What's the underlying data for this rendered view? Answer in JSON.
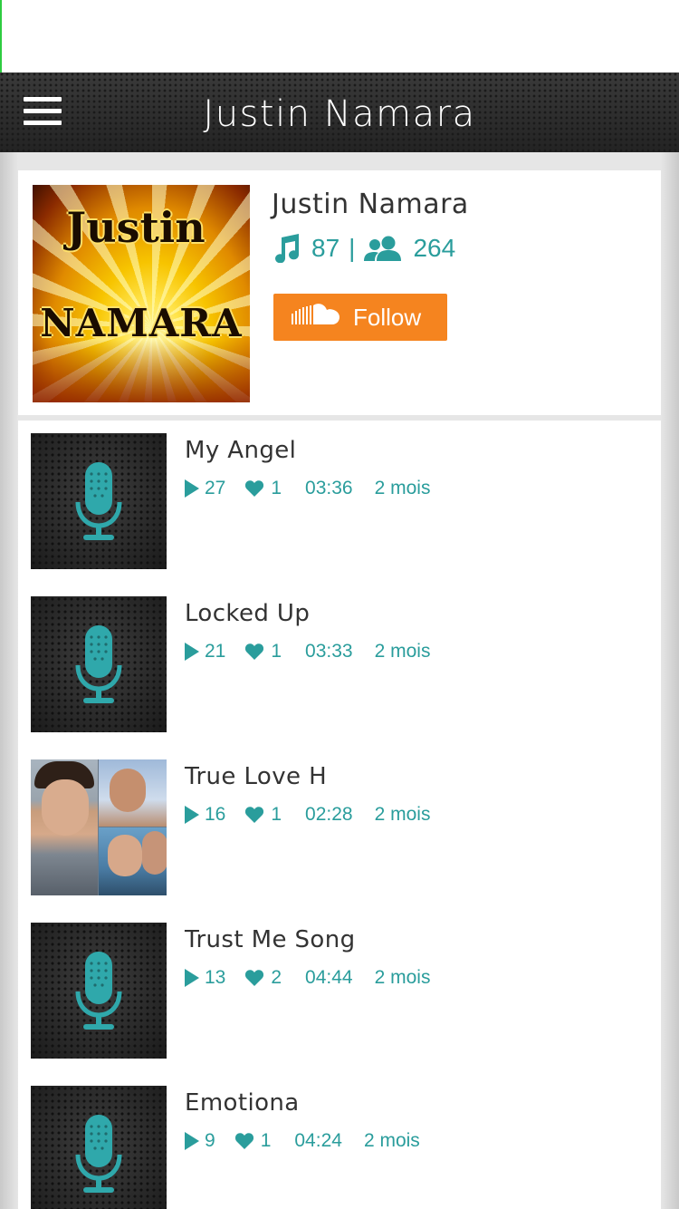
{
  "nav": {
    "title": "Justin Namara",
    "menu_icon": "hamburger-menu-icon"
  },
  "profile": {
    "name": "Justin Namara",
    "avatar_text_top": "Justin",
    "avatar_text_bottom": "NAMARA",
    "tracks_count": "87",
    "separator": "|",
    "followers_count": "264",
    "tracks_icon": "music-note-icon",
    "followers_icon": "users-icon",
    "follow_label": "Follow",
    "follow_icon": "soundcloud-icon"
  },
  "colors": {
    "accent": "#2a9d9c",
    "follow_button": "#f5841f",
    "navbar": "#2b2b2b",
    "text": "#333333"
  },
  "tracks": [
    {
      "title": "My Angel",
      "plays": "27",
      "likes": "1",
      "duration": "03:36",
      "age": "2 mois",
      "thumb": "microphone-icon"
    },
    {
      "title": "Locked Up",
      "plays": "21",
      "likes": "1",
      "duration": "03:33",
      "age": "2 mois",
      "thumb": "microphone-icon"
    },
    {
      "title": "True Love H",
      "plays": "16",
      "likes": "1",
      "duration": "02:28",
      "age": "2 mois",
      "thumb": "photo-collage"
    },
    {
      "title": "Trust Me Song",
      "plays": "13",
      "likes": "2",
      "duration": "04:44",
      "age": "2 mois",
      "thumb": "microphone-icon"
    },
    {
      "title": "Emotiona",
      "plays": "9",
      "likes": "1",
      "duration": "04:24",
      "age": "2 mois",
      "thumb": "microphone-icon"
    }
  ]
}
